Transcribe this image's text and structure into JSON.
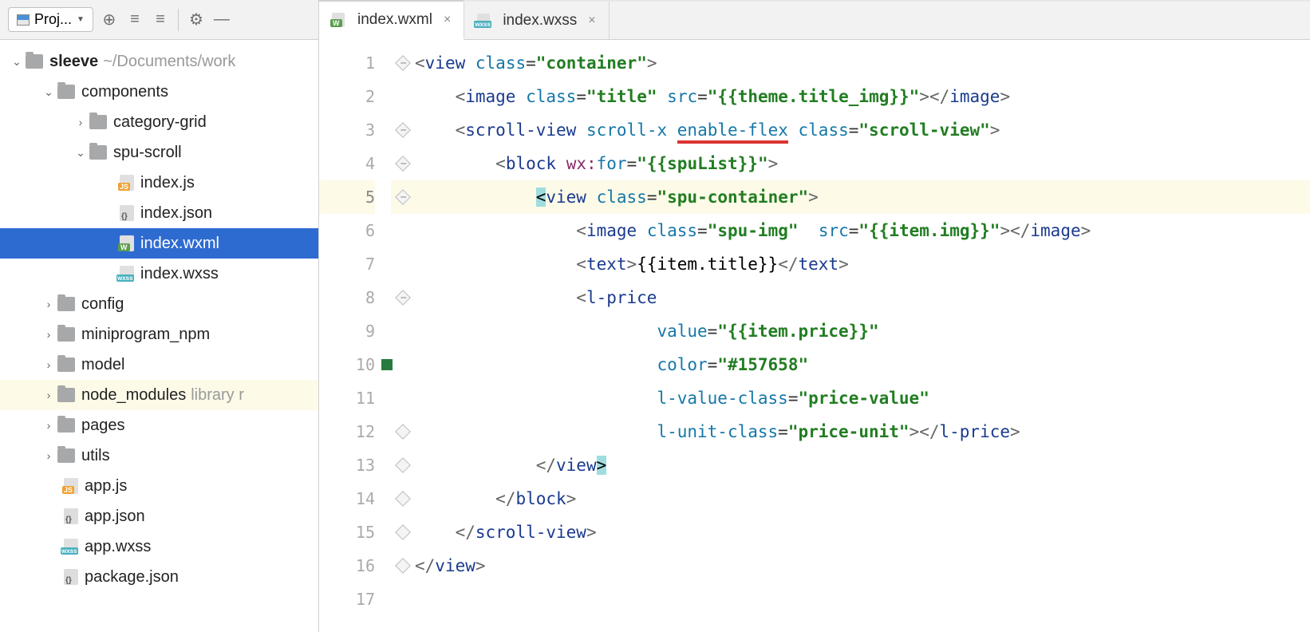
{
  "toolbar": {
    "project_label": "Proj..."
  },
  "tree": {
    "root": {
      "name": "sleeve",
      "path": "~/Documents/work"
    },
    "components": "components",
    "category_grid": "category-grid",
    "spu_scroll": "spu-scroll",
    "files": {
      "index_js": "index.js",
      "index_json": "index.json",
      "index_wxml": "index.wxml",
      "index_wxss": "index.wxss"
    },
    "config": "config",
    "miniprogram_npm": "miniprogram_npm",
    "model": "model",
    "node_modules": "node_modules",
    "node_modules_hint": "library r",
    "pages": "pages",
    "utils": "utils",
    "app_js": "app.js",
    "app_json": "app.json",
    "app_wxss": "app.wxss",
    "package_json": "package.json"
  },
  "tabs": [
    {
      "label": "index.wxml",
      "type": "wxml",
      "active": true
    },
    {
      "label": "index.wxss",
      "type": "wxss",
      "active": false
    }
  ],
  "editor": {
    "line_numbers": [
      1,
      2,
      3,
      4,
      5,
      6,
      7,
      8,
      9,
      10,
      11,
      12,
      13,
      14,
      15,
      16,
      17
    ],
    "current_line": 5,
    "marker_line": 10,
    "code_tokens": {
      "l1": {
        "tag": "view",
        "attr": "class",
        "val": "container"
      },
      "l2": {
        "tag": "image",
        "attr1": "class",
        "val1": "title",
        "attr2": "src",
        "val2": "{{theme.title_img}}"
      },
      "l3": {
        "tag": "scroll-view",
        "attr1": "scroll-x",
        "attr2": "enable-flex",
        "attr3": "class",
        "val3": "scroll-view"
      },
      "l4": {
        "tag": "block",
        "ns": "wx:",
        "attr": "for",
        "val": "{{spuList}}"
      },
      "l5": {
        "tag": "view",
        "attr": "class",
        "val": "spu-container"
      },
      "l6": {
        "tag": "image",
        "attr1": "class",
        "val1": "spu-img",
        "attr2": "src",
        "val2": "{{item.img}}"
      },
      "l7": {
        "tag": "text",
        "content": "{{item.title}}"
      },
      "l8": {
        "tag": "l-price"
      },
      "l9": {
        "attr": "value",
        "val": "{{item.price}}"
      },
      "l10": {
        "attr": "color",
        "val": "#157658"
      },
      "l11": {
        "attr": "l-value-class",
        "val": "price-value"
      },
      "l12": {
        "attr": "l-unit-class",
        "val": "price-unit",
        "close": "l-price"
      },
      "l13": {
        "close": "view"
      },
      "l14": {
        "close": "block"
      },
      "l15": {
        "close": "scroll-view"
      },
      "l16": {
        "close": "view"
      }
    }
  }
}
